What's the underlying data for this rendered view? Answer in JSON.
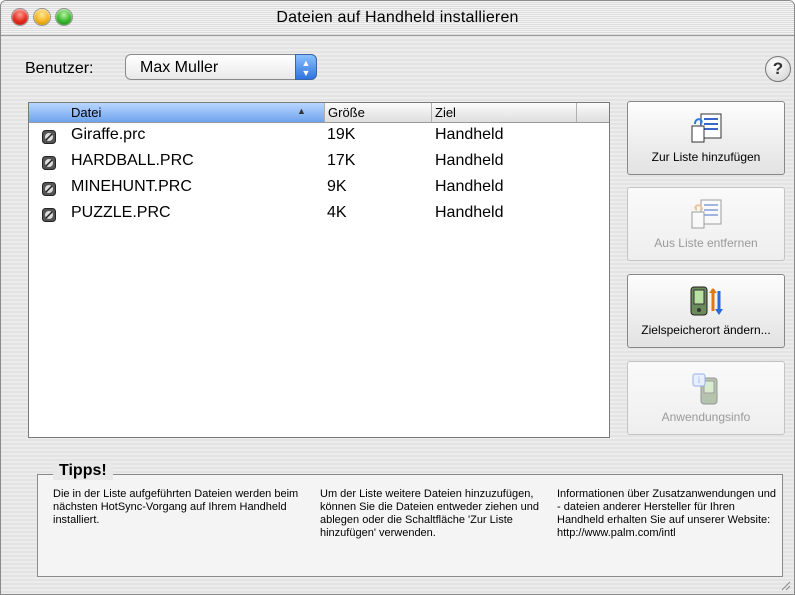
{
  "window": {
    "title": "Dateien auf Handheld installieren"
  },
  "user": {
    "label": "Benutzer:",
    "selected": "Max Muller"
  },
  "help": {
    "glyph": "?"
  },
  "file_list": {
    "columns": {
      "name": "Datei",
      "size": "Größe",
      "destination": "Ziel"
    },
    "rows": [
      {
        "name": "Giraffe.prc",
        "size": "19K",
        "destination": "Handheld"
      },
      {
        "name": "HARDBALL.PRC",
        "size": "17K",
        "destination": "Handheld"
      },
      {
        "name": "MINEHUNT.PRC",
        "size": "9K",
        "destination": "Handheld"
      },
      {
        "name": "PUZZLE.PRC",
        "size": "4K",
        "destination": "Handheld"
      }
    ]
  },
  "buttons": {
    "add": "Zur Liste hinzufügen",
    "remove": "Aus Liste entfernen",
    "change_destination": "Zielspeicherort ändern...",
    "app_info": "Anwendungsinfo"
  },
  "tips": {
    "title": "Tipps!",
    "col1": "Die in der Liste aufgeführten Dateien werden beim nächsten HotSync-Vorgang auf Ihrem Handheld installiert.",
    "col2": "Um der Liste weitere Dateien hinzuzufügen, können Sie die Dateien entweder ziehen und ablegen oder die Schaltfläche 'Zur Liste hinzufügen' verwenden.",
    "col3": "Informationen über Zusatzanwendungen und - dateien anderer Hersteller für Ihren Handheld erhalten Sie auf unserer Website: http://www.palm.com/intl"
  },
  "colors": {
    "selected_header": "#6ea3ee",
    "popup_accent": "#2e74e0",
    "close": "#e0281a",
    "minimize": "#f2b21b",
    "zoom": "#36b52a"
  }
}
